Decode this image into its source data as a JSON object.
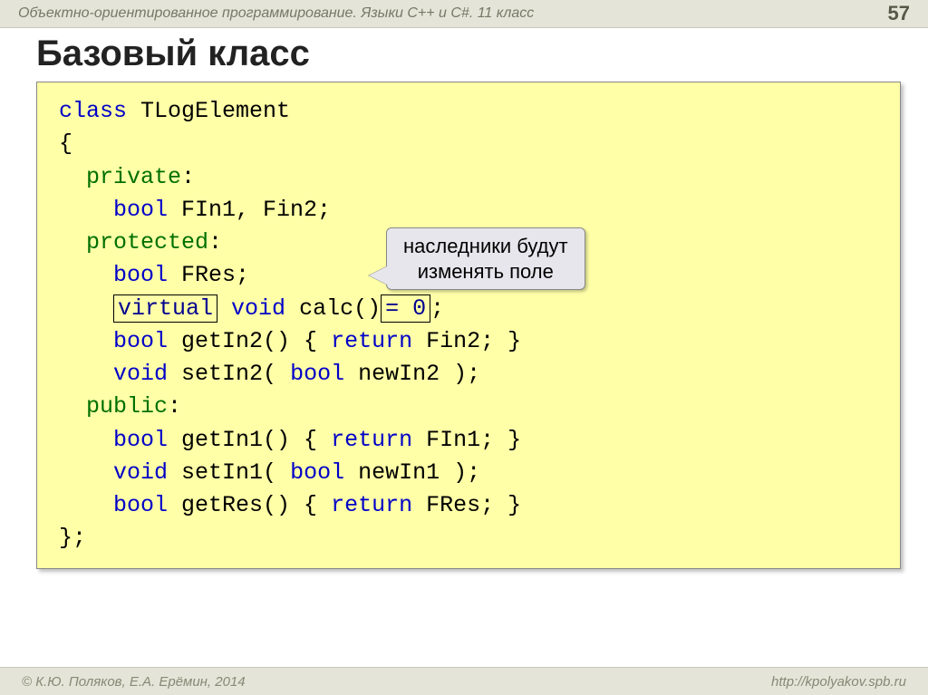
{
  "header": {
    "course_title": "Объектно-ориентированное программирование. Языки C++ и C#. 11 класс",
    "page_number": "57"
  },
  "slide": {
    "title": "Базовый класс"
  },
  "code": {
    "kw_class": "class",
    "classname": " TLogElement",
    "brace_open": "{",
    "kw_private": "private",
    "colon1": ":",
    "line_priv_fields_type": "bool",
    "line_priv_fields_rest": " FIn1, Fin2;",
    "kw_protected": "protected",
    "colon2": ":",
    "line_fres_type": "bool",
    "line_fres_rest": " FRes;",
    "kw_virtual": "virtual",
    "calc_void": " void",
    "calc_name": " calc()",
    "calc_eq0": "= 0",
    "calc_semi": ";",
    "getin2_type": "bool",
    "getin2_sig": " getIn2() { ",
    "getin2_ret": "return",
    "getin2_rest": " Fin2; }",
    "setin2_void": "void",
    "setin2_sig": " setIn2( ",
    "setin2_ptype": "bool",
    "setin2_rest": " newIn2 );",
    "kw_public": "public",
    "colon3": ":",
    "getin1_type": "bool",
    "getin1_sig": " getIn1() { ",
    "getin1_ret": "return",
    "getin1_rest": " FIn1; }",
    "setin1_void": "void",
    "setin1_sig": " setIn1( ",
    "setin1_ptype": "bool",
    "setin1_rest": " newIn1 );",
    "getres_type": "bool",
    "getres_sig": " getRes() { ",
    "getres_ret": "return",
    "getres_rest": " FRes; }",
    "brace_close": "};"
  },
  "callout": {
    "line1": "наследники будут",
    "line2": "изменять поле"
  },
  "footer": {
    "copyright": "© К.Ю. Поляков, Е.А. Ерёмин, 2014",
    "url": "http://kpolyakov.spb.ru"
  }
}
